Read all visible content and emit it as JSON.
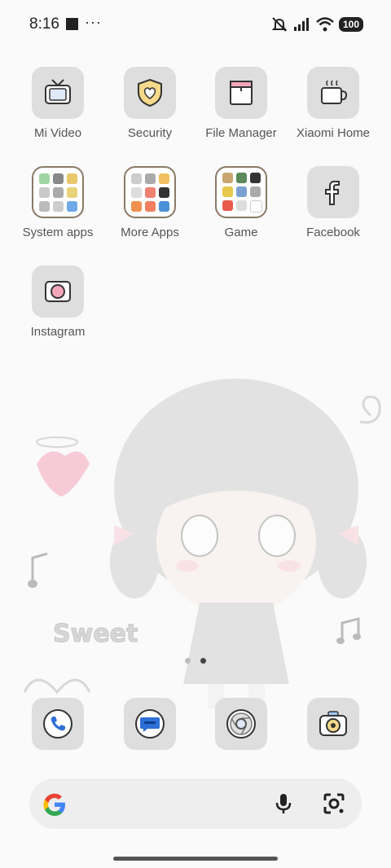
{
  "status_bar": {
    "time": "8:16",
    "more": "···",
    "battery": "100",
    "icons": [
      "notification-square-icon",
      "mute-bell-icon",
      "signal-icon",
      "wifi-icon",
      "battery-icon"
    ]
  },
  "apps": [
    {
      "label": "Mi Video",
      "icon": "tv-icon"
    },
    {
      "label": "Security",
      "icon": "shield-heart-icon"
    },
    {
      "label": "File Manager",
      "icon": "folder-icon"
    },
    {
      "label": "Xiaomi Home",
      "icon": "coffee-cup-icon"
    },
    {
      "label": "System apps",
      "icon": "folder-grid-icon"
    },
    {
      "label": "More Apps",
      "icon": "folder-grid-icon"
    },
    {
      "label": "Game",
      "icon": "folder-grid-icon"
    },
    {
      "label": "Facebook",
      "icon": "facebook-icon"
    },
    {
      "label": "Instagram",
      "icon": "camera-icon"
    }
  ],
  "wallpaper": {
    "text": "Sweet",
    "subject": "chibi-girl-illustration"
  },
  "page_indicator": {
    "pages": 2,
    "current": 2
  },
  "dock": [
    {
      "name": "phone",
      "icon": "phone-icon"
    },
    {
      "name": "messages",
      "icon": "message-icon"
    },
    {
      "name": "chrome",
      "icon": "chrome-icon"
    },
    {
      "name": "camera",
      "icon": "camera-icon"
    }
  ],
  "search": {
    "icons": [
      "google-logo-icon",
      "microphone-icon",
      "lens-icon"
    ]
  },
  "colors": {
    "icon_bg": "#dedede",
    "folder_border": "#8a7a65",
    "accent_pink": "#f4a6bb",
    "search_bg": "#eeeeee"
  }
}
